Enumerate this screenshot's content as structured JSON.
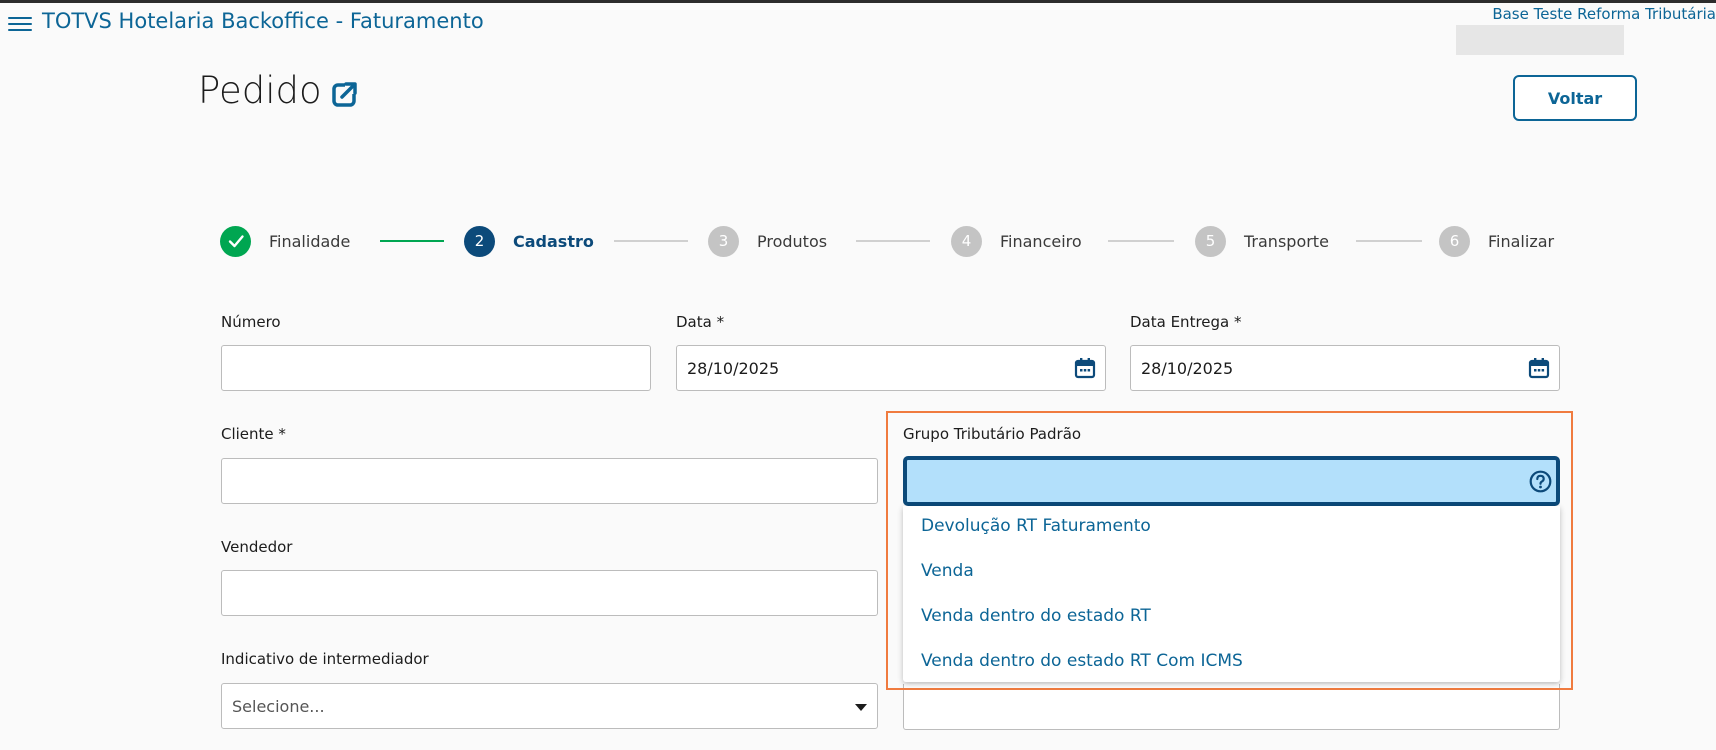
{
  "header": {
    "app_title": "TOTVS Hotelaria Backoffice - Faturamento",
    "environment": "Base Teste Reforma Tributária"
  },
  "page": {
    "title": "Pedido",
    "back_button": "Voltar"
  },
  "stepper": {
    "steps": [
      {
        "number": "✓",
        "label": "Finalidade",
        "state": "done"
      },
      {
        "number": "2",
        "label": "Cadastro",
        "state": "active"
      },
      {
        "number": "3",
        "label": "Produtos",
        "state": "pending"
      },
      {
        "number": "4",
        "label": "Financeiro",
        "state": "pending"
      },
      {
        "number": "5",
        "label": "Transporte",
        "state": "pending"
      },
      {
        "number": "6",
        "label": "Finalizar",
        "state": "pending"
      }
    ]
  },
  "form": {
    "numero": {
      "label": "Número",
      "value": ""
    },
    "data": {
      "label": "Data *",
      "value": "28/10/2025"
    },
    "data_entrega": {
      "label": "Data Entrega *",
      "value": "28/10/2025"
    },
    "cliente": {
      "label": "Cliente *",
      "value": ""
    },
    "grupo_tributario": {
      "label": "Grupo Tributário Padrão",
      "value": "",
      "options": [
        "Devolução RT Faturamento",
        "Venda",
        "Venda dentro do estado RT",
        "Venda dentro do estado RT Com ICMS"
      ]
    },
    "vendedor": {
      "label": "Vendedor",
      "value": ""
    },
    "intermediador": {
      "label": "Indicativo de intermediador",
      "placeholder": "Selecione..."
    }
  },
  "colors": {
    "primary": "#0c6596",
    "active_step": "#0c4a7a",
    "done_step": "#00a651",
    "highlight": "#f07b3f",
    "focused_input": "#b3e0fb"
  }
}
